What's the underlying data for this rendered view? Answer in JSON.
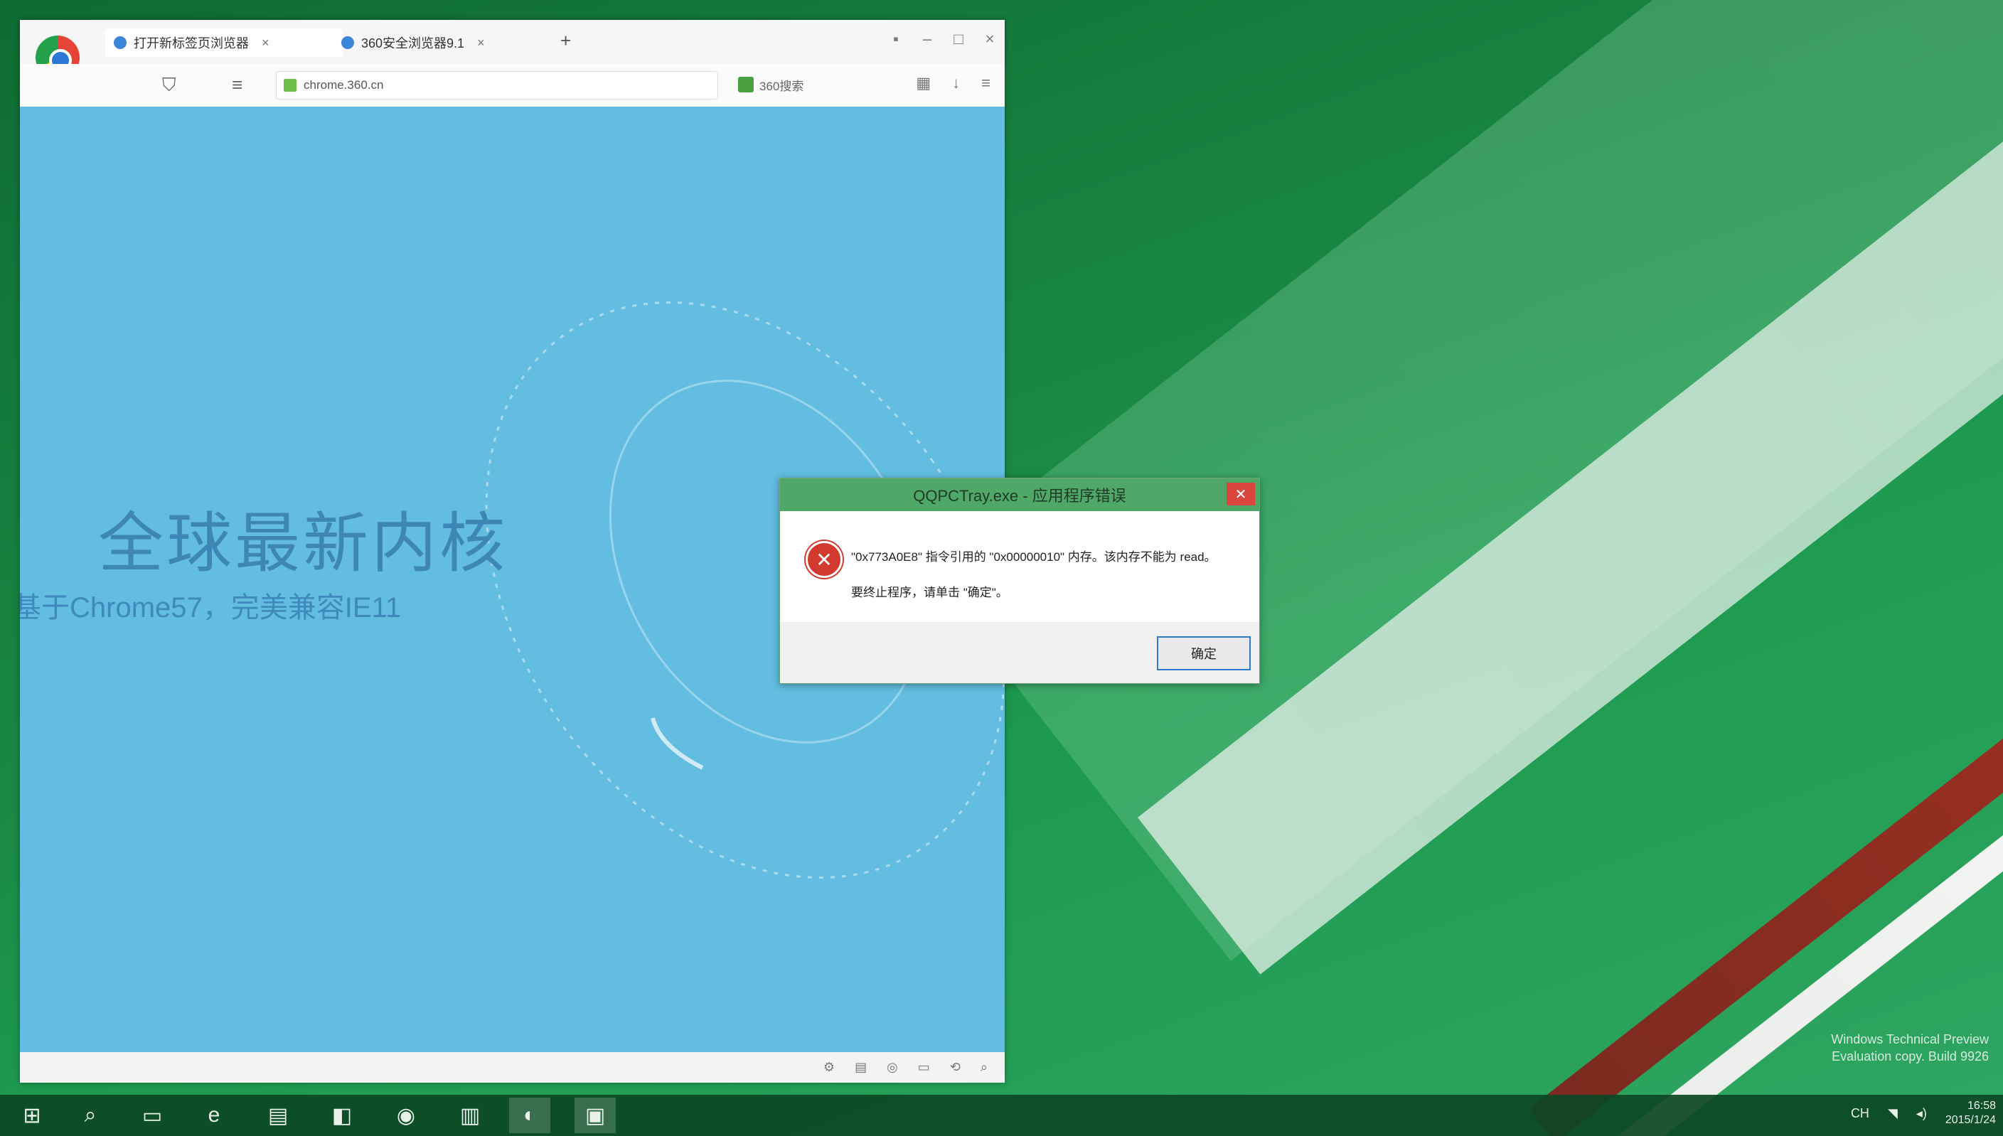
{
  "browser": {
    "tabs": [
      {
        "label": "打开新标签页浏览器"
      },
      {
        "label": "360安全浏览器9.1"
      }
    ],
    "address_bar": {
      "value": "chrome.360.cn"
    },
    "search_box": {
      "value": "360搜索"
    },
    "content": {
      "headline": "全球最新内核",
      "subline": "基于Chrome57，完美兼容IE11"
    }
  },
  "dialog": {
    "title": "QQPCTray.exe - 应用程序错误",
    "message_line1": "\"0x773A0E8\" 指令引用的 \"0x00000010\" 内存。该内存不能为 read。",
    "message_line2": "要终止程序，请单击 \"确定\"。",
    "ok_label": "确定",
    "close_glyph": "✕",
    "error_glyph": "✕"
  },
  "watermark": {
    "line1": "Windows Technical Preview",
    "line2": "Evaluation copy. Build 9926"
  },
  "taskbar": {
    "start_glyph": "⊞",
    "search_glyph": "⌕",
    "taskview_glyph": "▭",
    "ie_glyph": "e",
    "explorer_glyph": "▤",
    "store_glyph": "◧",
    "app1_glyph": "◉",
    "app2_glyph": "▥",
    "browser_glyph": "◐",
    "window_glyph": "▣"
  },
  "tray": {
    "ime": "CH",
    "time": "16:58",
    "date": "2015/1/24"
  }
}
